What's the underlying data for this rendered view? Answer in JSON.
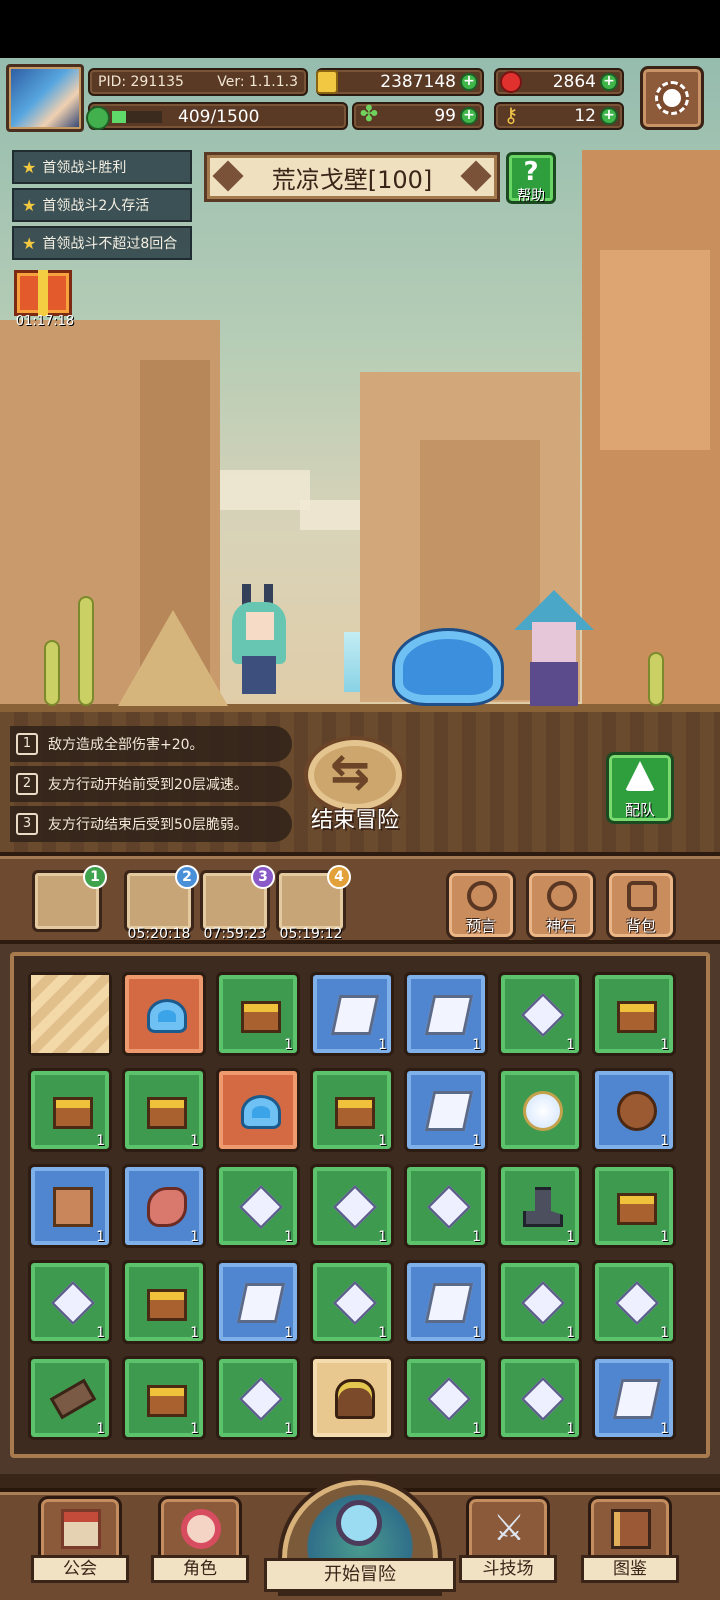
{
  "player": {
    "pid_label": "PID: 291135",
    "version_label": "Ver: 1.1.1.3",
    "exp": "409/1500",
    "exp_fraction": 0.27
  },
  "currencies": {
    "gold": "2387148",
    "ruby": "2864",
    "clover": "99",
    "key": "12"
  },
  "quests": [
    "首领战斗胜利",
    "首领战斗2人存活",
    "首领战斗不超过8回合"
  ],
  "gift_timer": "01:17:18",
  "stage_title": "荒凉戈壁[100]",
  "help_label": "帮助",
  "effects": [
    {
      "num": "1",
      "text": "敌方造成全部伤害+20。"
    },
    {
      "num": "2",
      "text": "友方行动开始前受到20层减速。"
    },
    {
      "num": "3",
      "text": "友方行动结束后受到50层脆弱。"
    }
  ],
  "end_adventure_label": "结束冒险",
  "team_label": "配队",
  "stage_slots": [
    {
      "badge": "1",
      "badge_color": "#3fa34d",
      "timer": ""
    },
    {
      "badge": "2",
      "badge_color": "#4a90d9",
      "timer": "05:20:18"
    },
    {
      "badge": "3",
      "badge_color": "#8a5ac8",
      "timer": "07:59:23"
    },
    {
      "badge": "4",
      "badge_color": "#e3a13a",
      "timer": "05:19:12"
    }
  ],
  "side_buttons": {
    "prophecy": "预言",
    "godstone": "神石",
    "backpack": "背包"
  },
  "inventory": [
    [
      {
        "bg": "sand",
        "icon": "sand-tile-icon",
        "count": ""
      },
      {
        "bg": "orange",
        "icon": "slime-icon",
        "count": ""
      },
      {
        "bg": "green",
        "icon": "gold-chest-icon",
        "count": "1"
      },
      {
        "bg": "blue",
        "icon": "ingot-icon",
        "count": "1"
      },
      {
        "bg": "blue",
        "icon": "ingot-icon",
        "count": "1"
      },
      {
        "bg": "green",
        "icon": "crystal-icon",
        "count": "1"
      },
      {
        "bg": "green",
        "icon": "treasure-chest-icon",
        "count": "1"
      }
    ],
    [
      {
        "bg": "green",
        "icon": "gold-chest-icon",
        "count": "1"
      },
      {
        "bg": "green",
        "icon": "gold-chest-icon",
        "count": "1"
      },
      {
        "bg": "orange",
        "icon": "slime-icon",
        "count": ""
      },
      {
        "bg": "green",
        "icon": "gold-chest-icon",
        "count": "1"
      },
      {
        "bg": "blue",
        "icon": "ingot-icon",
        "count": "1"
      },
      {
        "bg": "green",
        "icon": "orb-icon",
        "count": ""
      },
      {
        "bg": "blue",
        "icon": "bag-icon",
        "count": "1"
      }
    ],
    [
      {
        "bg": "blue",
        "icon": "box-icon",
        "count": "1"
      },
      {
        "bg": "blue",
        "icon": "meat-icon",
        "count": "1"
      },
      {
        "bg": "green",
        "icon": "crystal-icon",
        "count": "1"
      },
      {
        "bg": "green",
        "icon": "crystal-icon",
        "count": "1"
      },
      {
        "bg": "green",
        "icon": "crystal-icon",
        "count": "1"
      },
      {
        "bg": "green",
        "icon": "boot-icon",
        "count": "1"
      },
      {
        "bg": "green",
        "icon": "gold-chest-icon",
        "count": "1"
      }
    ],
    [
      {
        "bg": "green",
        "icon": "crystal-icon",
        "count": "1"
      },
      {
        "bg": "green",
        "icon": "chest-icon",
        "count": "1"
      },
      {
        "bg": "blue",
        "icon": "ingot-icon",
        "count": "1"
      },
      {
        "bg": "green",
        "icon": "crystal-icon",
        "count": "1"
      },
      {
        "bg": "blue",
        "icon": "ingot-icon",
        "count": "1"
      },
      {
        "bg": "green",
        "icon": "crystal-icon",
        "count": "1"
      },
      {
        "bg": "green",
        "icon": "crystal-icon",
        "count": "1"
      }
    ],
    [
      {
        "bg": "green",
        "icon": "scroll-icon",
        "count": "1"
      },
      {
        "bg": "green",
        "icon": "gold-chest-icon",
        "count": "1"
      },
      {
        "bg": "green",
        "icon": "crystal-icon",
        "count": "1"
      },
      {
        "bg": "sand",
        "icon": "campfire-pot-icon",
        "count": ""
      },
      {
        "bg": "green",
        "icon": "crystal-icon",
        "count": "1"
      },
      {
        "bg": "green",
        "icon": "crystal-icon",
        "count": "1"
      },
      {
        "bg": "blue",
        "icon": "ingot-icon",
        "count": "1"
      }
    ]
  ],
  "nav": {
    "guild": "公会",
    "character": "角色",
    "start_adventure": "开始冒险",
    "arena": "斗技场",
    "codex": "图鉴"
  }
}
